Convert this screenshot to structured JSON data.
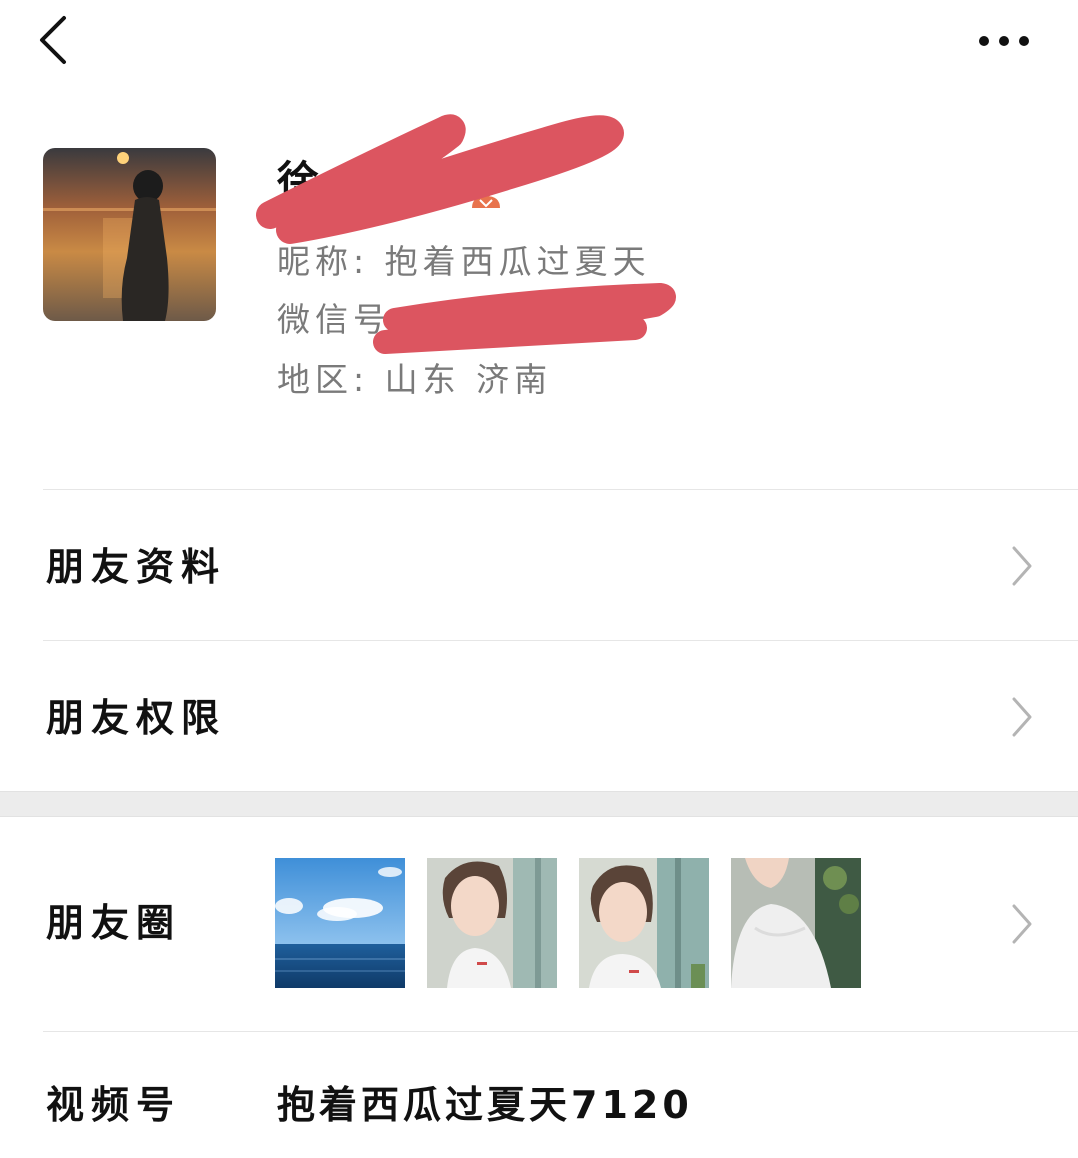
{
  "header": {
    "back_icon": "chevron-left-icon",
    "more_icon": "more-dots-icon"
  },
  "profile": {
    "display_name": "徐",
    "nickname_label": "昵称: ",
    "nickname": "抱着西瓜过夏天",
    "wechat_id_label": "微信号",
    "region_label": "地区: ",
    "region": "山东 济南"
  },
  "menu": {
    "friend_info": "朋友资料",
    "friend_permissions": "朋友权限",
    "moments": "朋友圈",
    "channels_label": "视频号",
    "channels_value": "抱着西瓜过夏天7120"
  },
  "colors": {
    "redaction": "#dc5560",
    "secondary_text": "#7a7a7a",
    "gender_badge": "#e8734d"
  }
}
